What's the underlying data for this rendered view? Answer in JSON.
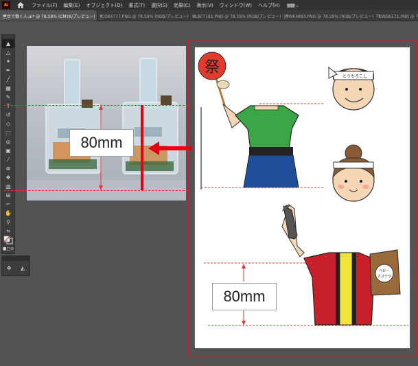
{
  "app": {
    "logo_text": "Ai",
    "workspace_icon": "▦▦ ⌄"
  },
  "menu": [
    "ファイル(F)",
    "編集(E)",
    "オブジェクト(O)",
    "書式(T)",
    "選択(S)",
    "効果(C)",
    "表示(V)",
    "ウィンドウ(W)",
    "ヘルプ(H)"
  ],
  "tabs": [
    {
      "label": "屋台で働く人.ai* @ 78.59% (CMYK/プレビュー)",
      "active": true
    },
    {
      "label": "JCOK6777.PNG @ 78.59% (RGB/プレビュー)",
      "active": false
    },
    {
      "label": "ULBF7161.PNG @ 78.59% (RGB/プレビュー)",
      "active": false
    },
    {
      "label": "JOWK4893.PNG @ 78.59% (RGB/プレビュー)",
      "active": false
    },
    {
      "label": "TCWD6171.PNG @ 78.59% (RGB/プレビュー)",
      "active": false
    }
  ],
  "tab_close_glyph": "×",
  "canvas": {
    "photo_measure_label": "80mm",
    "artboard_measure_label": "80mm",
    "uchiwa_text": "祭",
    "headband_text": "とうもろこし",
    "sign_text_line1": "ベビー",
    "sign_text_line2": "カステラ"
  },
  "colors": {
    "guide_red": "#e8352f",
    "arrow_red": "#e60012",
    "shirt_green": "#3aa645",
    "apron_blue": "#1f4f9a",
    "happi_red": "#c8202a",
    "happi_yellow": "#f2e33a"
  }
}
